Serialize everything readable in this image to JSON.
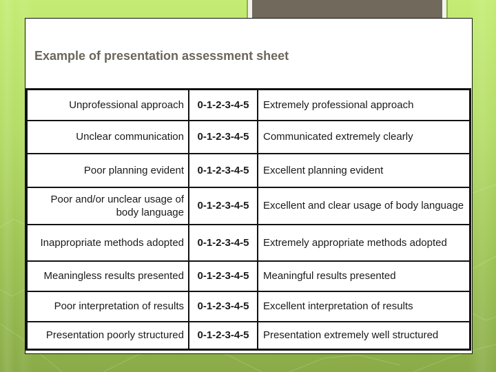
{
  "slide": {
    "title": "Example of presentation assessment sheet",
    "colors": {
      "title": "#6b665a",
      "header_box": "#71695b",
      "header_box_border": "#8cb23c",
      "background_top": "#c4ec74",
      "background_bottom": "#8aab48"
    }
  },
  "sheet": {
    "rows": [
      {
        "negative": "Unprofessional approach",
        "scale": "0-1-2-3-4-5",
        "positive": "Extremely professional approach"
      },
      {
        "negative": "Unclear communication",
        "scale": "0-1-2-3-4-5",
        "positive": "Communicated extremely clearly"
      },
      {
        "negative": "Poor planning evident",
        "scale": "0-1-2-3-4-5",
        "positive": "Excellent planning evident"
      },
      {
        "negative": "Poor and/or unclear usage of body language",
        "scale": "0-1-2-3-4-5",
        "positive": "Excellent and clear usage of body language"
      },
      {
        "negative": "Inappropriate methods adopted",
        "scale": "0-1-2-3-4-5",
        "positive": "Extremely appropriate methods adopted"
      },
      {
        "negative": "Meaningless results presented",
        "scale": "0-1-2-3-4-5",
        "positive": "Meaningful results presented"
      },
      {
        "negative": "Poor interpretation of results",
        "scale": "0-1-2-3-4-5",
        "positive": "Excellent interpretation of results"
      },
      {
        "negative": "Presentation poorly structured",
        "scale": "0-1-2-3-4-5",
        "positive": "Presentation extremely well structured"
      }
    ]
  }
}
